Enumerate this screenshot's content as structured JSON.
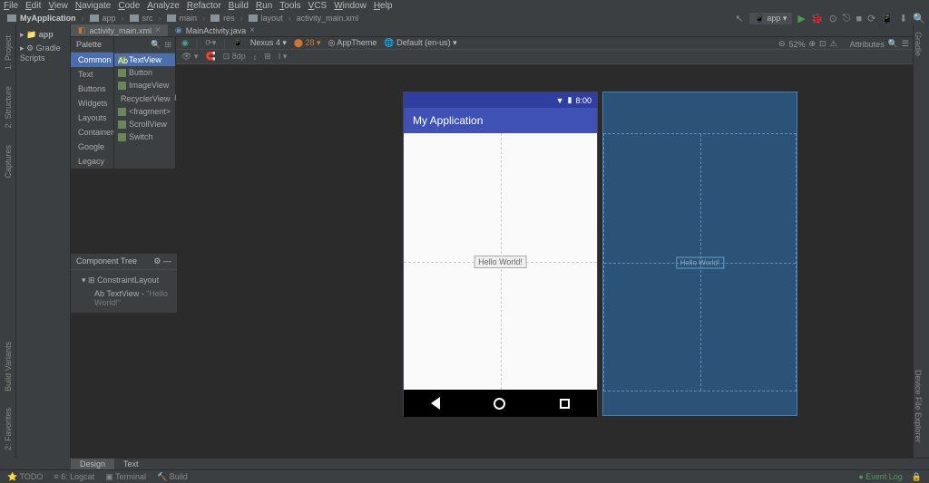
{
  "menubar": [
    "File",
    "Edit",
    "View",
    "Navigate",
    "Code",
    "Analyze",
    "Refactor",
    "Build",
    "Run",
    "Tools",
    "VCS",
    "Window",
    "Help"
  ],
  "breadcrumb": {
    "items": [
      "MyApplication",
      "app",
      "src",
      "main",
      "res",
      "layout",
      "activity_main.xml"
    ]
  },
  "run_config": "app",
  "tabs": [
    {
      "label": "activity_main.xml",
      "active": true
    },
    {
      "label": "MainActivity.java",
      "active": false
    }
  ],
  "project": {
    "root": "app",
    "scripts": "Gradle Scripts"
  },
  "palette": {
    "title": "Palette",
    "categories": [
      "Common",
      "Text",
      "Buttons",
      "Widgets",
      "Layouts",
      "Containers",
      "Google",
      "Legacy"
    ],
    "active_cat": "Common",
    "widgets": [
      "TextView",
      "Button",
      "ImageView",
      "RecyclerView",
      "<fragment>",
      "ScrollView",
      "Switch"
    ],
    "active_widget": "TextView"
  },
  "component_tree": {
    "title": "Component Tree",
    "root": "ConstraintLayout",
    "child_type": "TextView",
    "child_text": "\"Hello World!\""
  },
  "designer_toolbar": {
    "device": "Nexus 4",
    "api": "28",
    "theme": "AppTheme",
    "locale": "Default (en-us)"
  },
  "zoom": {
    "percent": "52%"
  },
  "attributes_label": "Attributes",
  "phone": {
    "time": "8:00",
    "app_title": "My Application",
    "widget_text": "Hello World!"
  },
  "blueprint": {
    "widget_text": "Hello World!"
  },
  "bottom_tabs": [
    "Design",
    "Text"
  ],
  "active_bottom_tab": "Design",
  "statusbar": {
    "items": [
      "TODO",
      "6: Logcat",
      "Terminal",
      "Build"
    ],
    "event_log": "Event Log"
  },
  "left_tools": [
    "1: Project",
    "2: Structure",
    "Captures",
    "Build Variants",
    "2: Favorites"
  ],
  "right_tools": [
    "Gradle",
    "Device File Explorer"
  ]
}
